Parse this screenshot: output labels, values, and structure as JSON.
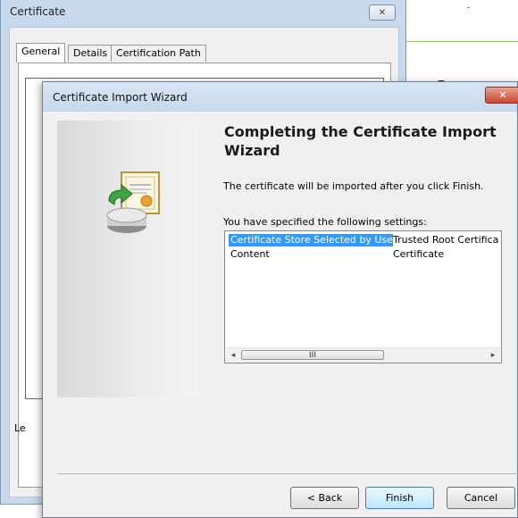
{
  "certificate_window": {
    "title": "Certificate",
    "close_glyph": "✕",
    "tabs": [
      {
        "label": "General"
      },
      {
        "label": "Details"
      },
      {
        "label": "Certification Path"
      }
    ],
    "partial_label": "Le"
  },
  "wizard": {
    "title": "Certificate Import Wizard",
    "close_glyph": "✕",
    "icon": "certificate-import-icon",
    "heading": "Completing the Certificate Import Wizard",
    "info_text": "The certificate will be imported after you click Finish.",
    "settings_label": "You have specified the following settings:",
    "settings": [
      {
        "name": "Certificate Store Selected by User",
        "value": "Trusted Root Certifica"
      },
      {
        "name": "Content",
        "value": "Certificate"
      }
    ],
    "scrollbar": {
      "left_glyph": "◂",
      "thumb_glyph": "III",
      "right_glyph": "▸"
    },
    "buttons": {
      "back": "< Back",
      "finish": "Finish",
      "cancel": "Cancel"
    }
  },
  "colors": {
    "selection": "#3399ff",
    "close_red": "#c8472f",
    "accent_green": "#8dc63f"
  }
}
